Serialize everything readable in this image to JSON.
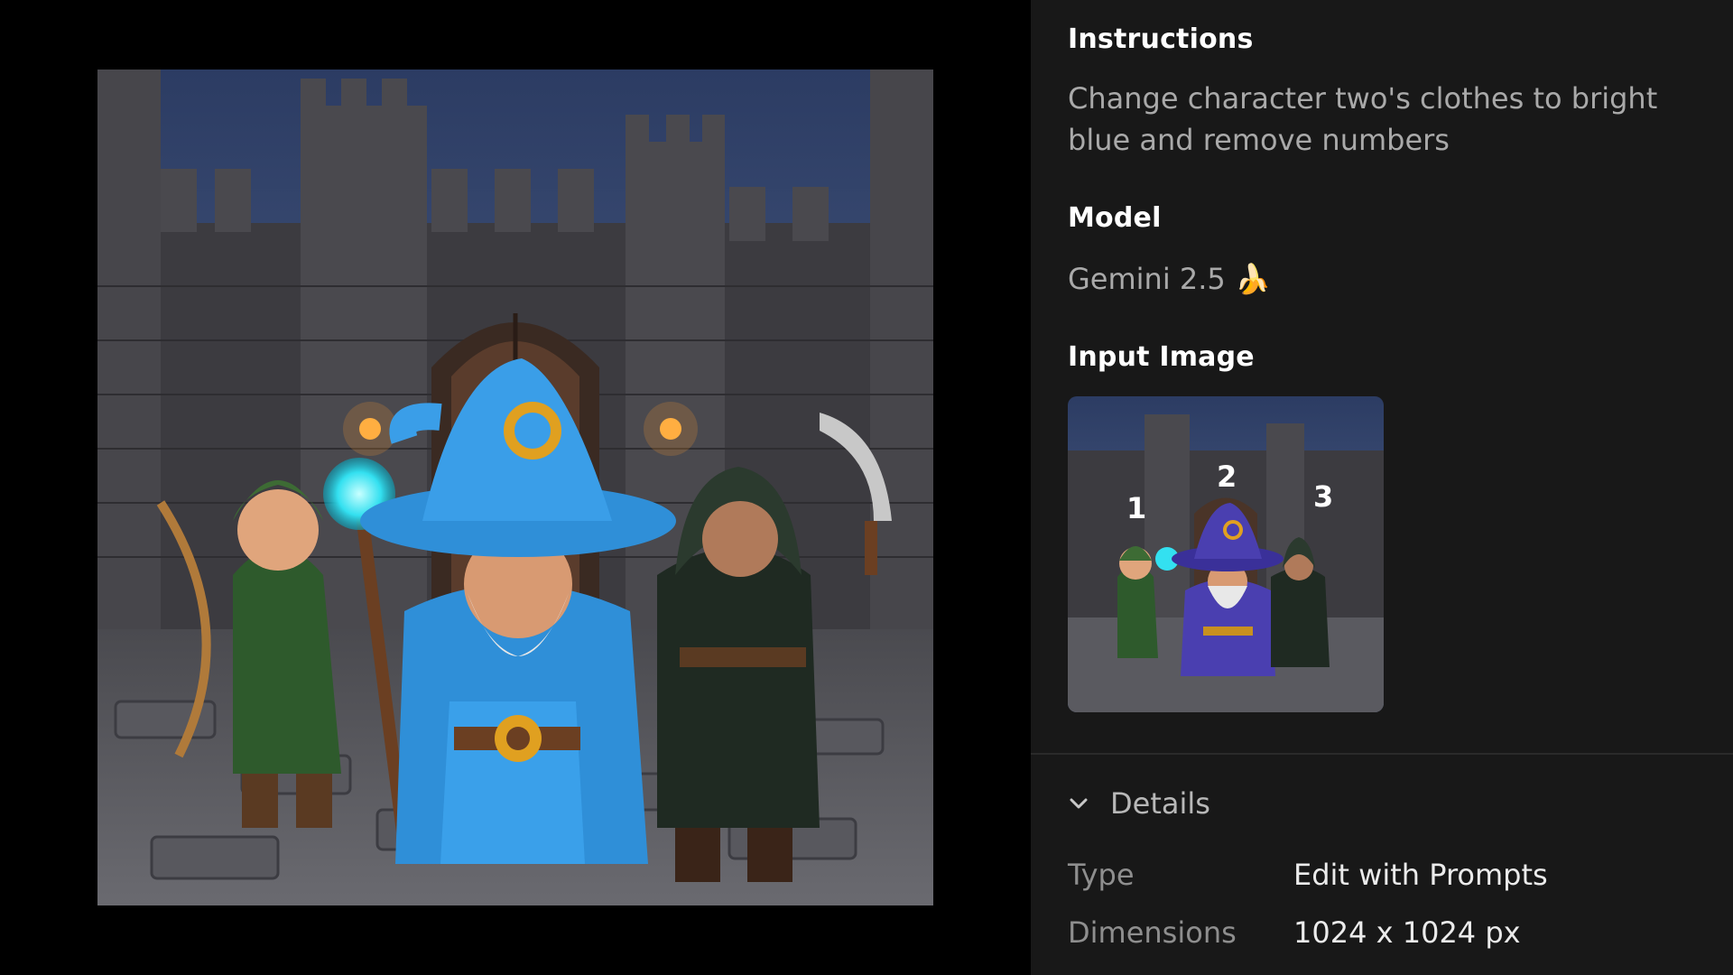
{
  "main_image": {
    "icon": "fantasy-characters-image"
  },
  "panel": {
    "instructions": {
      "title": "Instructions",
      "text": "Change character two's clothes to bright blue and remove numbers"
    },
    "model": {
      "title": "Model",
      "value": "Gemini 2.5 🍌"
    },
    "input_image": {
      "title": "Input Image",
      "labels": [
        "1",
        "2",
        "3"
      ]
    },
    "details": {
      "label": "Details",
      "rows": [
        {
          "key": "Type",
          "value": "Edit with Prompts"
        },
        {
          "key": "Dimensions",
          "value": "1024 x 1024 px"
        }
      ]
    }
  },
  "colors": {
    "background": "#000000",
    "panel": "#181818",
    "heading": "#ffffff",
    "muted": "#a9a9a9"
  }
}
